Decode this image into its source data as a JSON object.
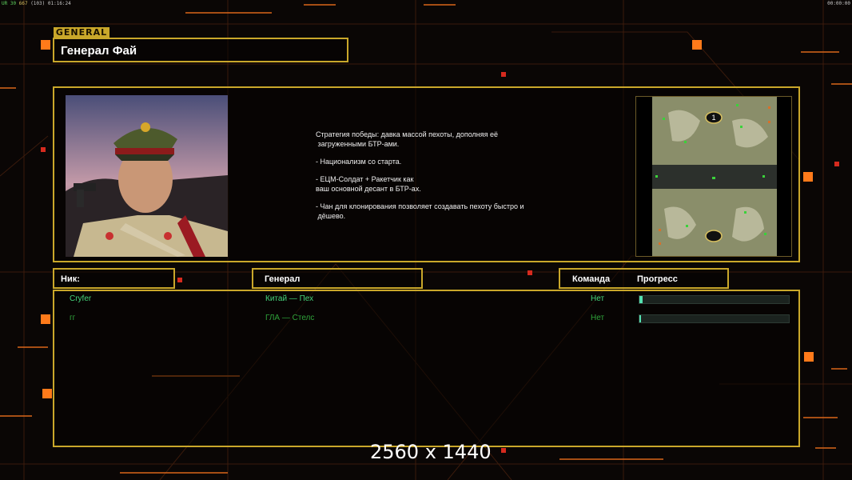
{
  "hud": {
    "left_text_1": "UR",
    "left_text_2": "30",
    "left_text_3": "667",
    "left_text_4": "(103)",
    "left_time": "01:16:24",
    "right_time": "00:00:00"
  },
  "general_tab": "GENERAL",
  "general_name": "Генерал Фай",
  "description": [
    "Стратегия победы: давка массой пехоты, дополняя её\n загруженными БТР-ами.",
    "- Национализм со старта.",
    "- ЕЦМ-Солдат + Ракетчик как\nваш основной десант в БТР-ах.",
    "- Чан для клонирования позволяет создавать пехоту быстро и\n дёшево."
  ],
  "map": {
    "start_1": "1"
  },
  "table": {
    "col_nick": "Ник:",
    "col_general": "Генерал",
    "col_team": "Команда",
    "col_progress": "Прогресс",
    "rows": [
      {
        "nick": "Cryfer",
        "general": "Китай — Пех",
        "team": "Нет",
        "progress": 0.02,
        "color": "#45d47a"
      },
      {
        "nick": "гг",
        "general": "ГЛА — Стелс",
        "team": "Нет",
        "progress": 0.01,
        "color": "#2fa33a"
      }
    ]
  },
  "resolution_label": "2560 x 1440",
  "colors": {
    "frame": "#c9a72a",
    "accent": "#ff7a1a"
  }
}
